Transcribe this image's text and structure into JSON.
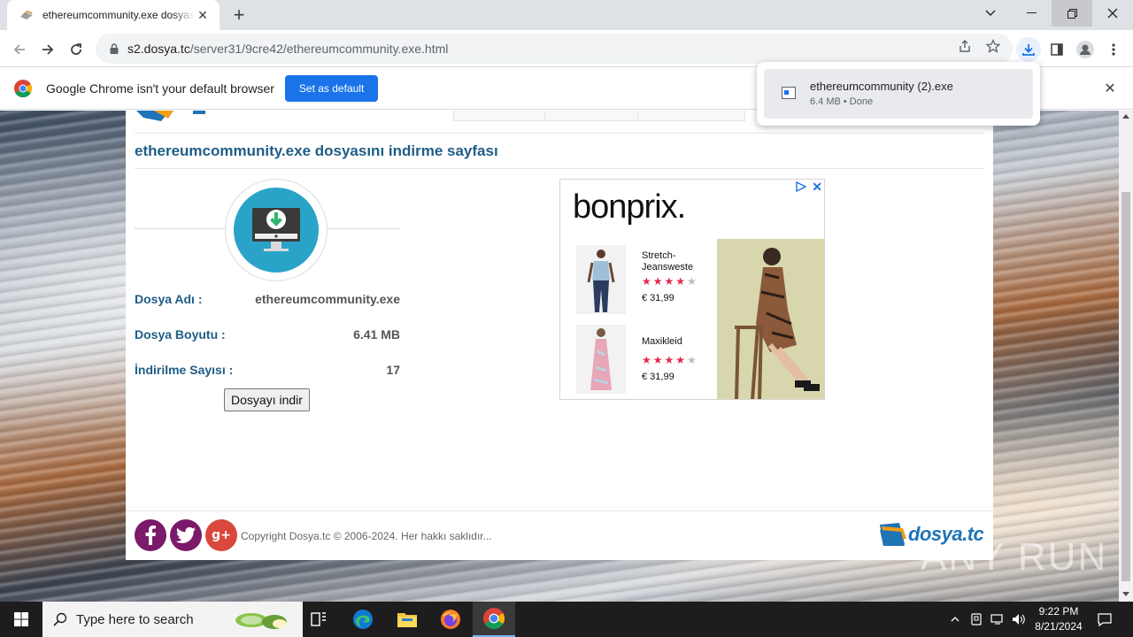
{
  "browser": {
    "tab_title": "ethereumcommunity.exe dosyasını indirme sayfası",
    "url_host": "s2.dosya.tc",
    "url_path": "/server31/9cre42/ethereumcommunity.exe.html",
    "new_tab_label": "+"
  },
  "infobar": {
    "message": "Google Chrome isn't your default browser",
    "button_label": "Set as default"
  },
  "download_bubble": {
    "file_name": "ethereumcommunity (2).exe",
    "status": "6.4 MB • Done"
  },
  "page": {
    "heading": "ethereumcommunity.exe dosyasını indirme sayfası",
    "info": [
      {
        "label": "Dosya Adı :",
        "value": "ethereumcommunity.exe"
      },
      {
        "label": "Dosya Boyutu :",
        "value": "6.41 MB"
      },
      {
        "label": "İndirilme Sayısı :",
        "value": "17"
      }
    ],
    "download_button": "Dosyayı indir",
    "copyright": "Copyright Dosya.tc © 2006-2024. Her hakkı saklıdır...",
    "brand_logo_text": "dosya.tc"
  },
  "ad": {
    "brand": "bonprix.",
    "products": [
      {
        "name": "Stretch-Jeansweste",
        "rating": 4,
        "price": "€ 31,99"
      },
      {
        "name": "Maxikleid",
        "rating": 4,
        "price": "€ 31,99"
      }
    ]
  },
  "watermark": "ANY RUN",
  "taskbar": {
    "search_placeholder": "Type here to search",
    "time": "9:22 PM",
    "date": "8/21/2024"
  },
  "colors": {
    "accent": "#1a73e8",
    "heading": "#1f5d86",
    "download_icon_bg": "#2aa3c9",
    "social": "#7b1a6b",
    "gplus": "#d9473d"
  }
}
